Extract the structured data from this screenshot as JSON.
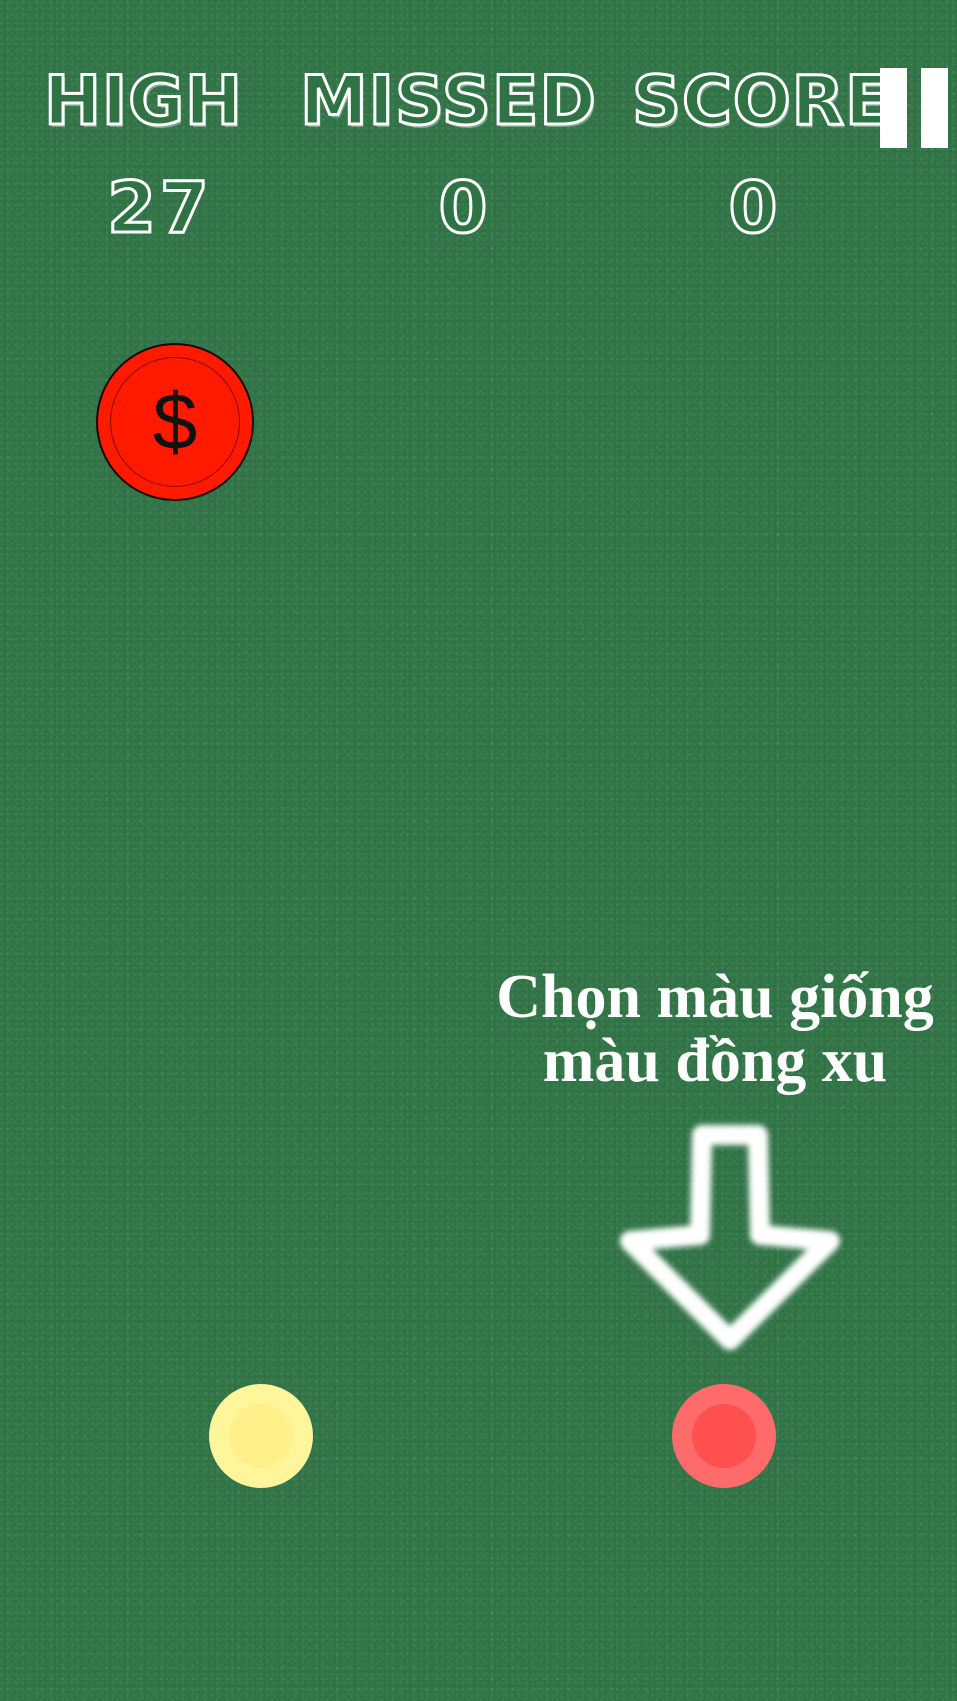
{
  "hud": {
    "high_label": "HIGH",
    "missed_label": "MISSED",
    "score_label": "SCORE",
    "high_value": "27",
    "missed_value": "0",
    "score_value": "0"
  },
  "pause": {
    "icon": "pause-icon"
  },
  "falling_coin": {
    "symbol": "$",
    "color": "#ff1a00"
  },
  "hint": {
    "line1": "Chọn màu giống",
    "line2": "màu đồng xu",
    "arrow_icon": "down-arrow-icon"
  },
  "color_choices": [
    {
      "name": "yellow",
      "outer": "#fff59a",
      "inner": "#fff08a"
    },
    {
      "name": "red",
      "outer": "#ff6b6b",
      "inner": "#ff5050"
    }
  ],
  "colors": {
    "background": "#2f7345",
    "text": "#ffffff"
  }
}
